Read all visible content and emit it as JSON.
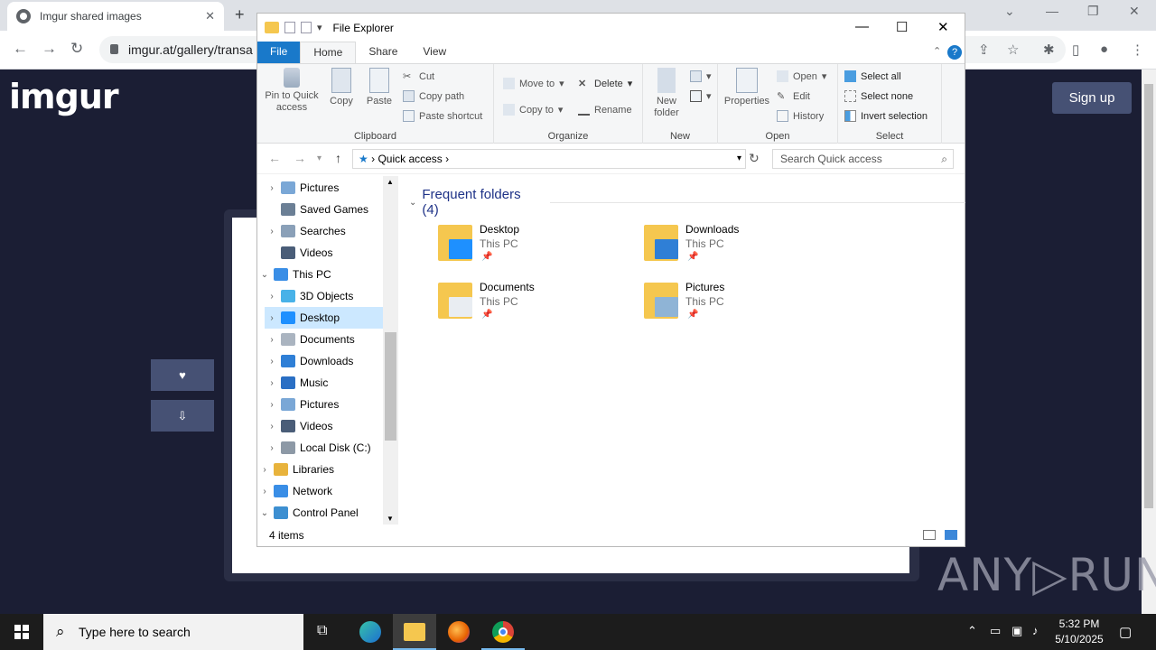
{
  "browser": {
    "tab_title": "Imgur shared images",
    "tab_close": "✕",
    "new_tab": "+",
    "url": "imgur.at/gallery/transa",
    "nav": {
      "back": "←",
      "forward": "→",
      "reload": "↻"
    }
  },
  "page": {
    "logo": "imgur",
    "signup_label": "Sign up",
    "upvote": "♥",
    "downvote": "⇩",
    "watermark": "ANY▷RUN"
  },
  "explorer": {
    "title": "File Explorer",
    "tabs": [
      "File",
      "Home",
      "Share",
      "View"
    ],
    "ribbon": {
      "clipboard": {
        "label": "Clipboard",
        "pin": "Pin to Quick access",
        "copy": "Copy",
        "paste": "Paste",
        "cut": "Cut",
        "copy_path": "Copy path",
        "paste_shortcut": "Paste shortcut"
      },
      "organize": {
        "label": "Organize",
        "move_to": "Move to",
        "copy_to": "Copy to",
        "delete": "Delete",
        "rename": "Rename"
      },
      "new": {
        "label": "New",
        "new_folder": "New folder"
      },
      "open": {
        "label": "Open",
        "properties": "Properties",
        "open": "Open",
        "edit": "Edit",
        "history": "History"
      },
      "select": {
        "label": "Select",
        "select_all": "Select all",
        "select_none": "Select none",
        "invert": "Invert selection"
      }
    },
    "address": {
      "location": "Quick access",
      "search_placeholder": "Search Quick access"
    },
    "nav_items": [
      {
        "label": "Pictures",
        "color": "#7aa7d6"
      },
      {
        "label": "Saved Games",
        "color": "#6b7f95"
      },
      {
        "label": "Searches",
        "color": "#8aa0b8"
      },
      {
        "label": "Videos",
        "color": "#4a5d78"
      },
      {
        "label": "This PC",
        "color": "#3a8ee6"
      },
      {
        "label": "3D Objects",
        "color": "#48b2e8"
      },
      {
        "label": "Desktop",
        "color": "#1e90ff"
      },
      {
        "label": "Documents",
        "color": "#aab4c0"
      },
      {
        "label": "Downloads",
        "color": "#2f7fd6"
      },
      {
        "label": "Music",
        "color": "#2a6fc4"
      },
      {
        "label": "Pictures",
        "color": "#7aa7d6"
      },
      {
        "label": "Videos",
        "color": "#4a5d78"
      },
      {
        "label": "Local Disk (C:)",
        "color": "#8d99a6"
      },
      {
        "label": "Libraries",
        "color": "#e8b33c"
      },
      {
        "label": "Network",
        "color": "#3a8ee6"
      },
      {
        "label": "Control Panel",
        "color": "#3d8fd1"
      }
    ],
    "frequent_heading": "Frequent folders (4)",
    "folders": [
      {
        "name": "Desktop",
        "location": "This PC",
        "overlay": "#1e90ff"
      },
      {
        "name": "Downloads",
        "location": "This PC",
        "overlay": "#2f7fd6"
      },
      {
        "name": "Documents",
        "location": "This PC",
        "overlay": "#e9edf2"
      },
      {
        "name": "Pictures",
        "location": "This PC",
        "overlay": "#8fb4d6"
      }
    ],
    "status": "4 items"
  },
  "taskbar": {
    "search_placeholder": "Type here to search",
    "time": "5:32 PM",
    "date": "5/10/2025"
  }
}
